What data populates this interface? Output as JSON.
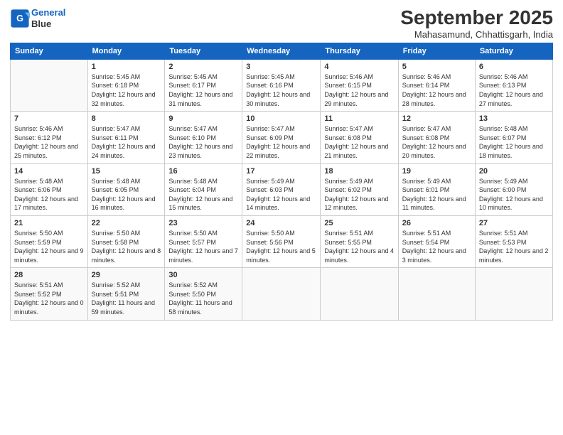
{
  "header": {
    "logo_line1": "General",
    "logo_line2": "Blue",
    "month_title": "September 2025",
    "location": "Mahasamund, Chhattisgarh, India"
  },
  "weekdays": [
    "Sunday",
    "Monday",
    "Tuesday",
    "Wednesday",
    "Thursday",
    "Friday",
    "Saturday"
  ],
  "weeks": [
    [
      {
        "day": "",
        "sunrise": "",
        "sunset": "",
        "daylight": ""
      },
      {
        "day": "1",
        "sunrise": "Sunrise: 5:45 AM",
        "sunset": "Sunset: 6:18 PM",
        "daylight": "Daylight: 12 hours and 32 minutes."
      },
      {
        "day": "2",
        "sunrise": "Sunrise: 5:45 AM",
        "sunset": "Sunset: 6:17 PM",
        "daylight": "Daylight: 12 hours and 31 minutes."
      },
      {
        "day": "3",
        "sunrise": "Sunrise: 5:45 AM",
        "sunset": "Sunset: 6:16 PM",
        "daylight": "Daylight: 12 hours and 30 minutes."
      },
      {
        "day": "4",
        "sunrise": "Sunrise: 5:46 AM",
        "sunset": "Sunset: 6:15 PM",
        "daylight": "Daylight: 12 hours and 29 minutes."
      },
      {
        "day": "5",
        "sunrise": "Sunrise: 5:46 AM",
        "sunset": "Sunset: 6:14 PM",
        "daylight": "Daylight: 12 hours and 28 minutes."
      },
      {
        "day": "6",
        "sunrise": "Sunrise: 5:46 AM",
        "sunset": "Sunset: 6:13 PM",
        "daylight": "Daylight: 12 hours and 27 minutes."
      }
    ],
    [
      {
        "day": "7",
        "sunrise": "Sunrise: 5:46 AM",
        "sunset": "Sunset: 6:12 PM",
        "daylight": "Daylight: 12 hours and 25 minutes."
      },
      {
        "day": "8",
        "sunrise": "Sunrise: 5:47 AM",
        "sunset": "Sunset: 6:11 PM",
        "daylight": "Daylight: 12 hours and 24 minutes."
      },
      {
        "day": "9",
        "sunrise": "Sunrise: 5:47 AM",
        "sunset": "Sunset: 6:10 PM",
        "daylight": "Daylight: 12 hours and 23 minutes."
      },
      {
        "day": "10",
        "sunrise": "Sunrise: 5:47 AM",
        "sunset": "Sunset: 6:09 PM",
        "daylight": "Daylight: 12 hours and 22 minutes."
      },
      {
        "day": "11",
        "sunrise": "Sunrise: 5:47 AM",
        "sunset": "Sunset: 6:08 PM",
        "daylight": "Daylight: 12 hours and 21 minutes."
      },
      {
        "day": "12",
        "sunrise": "Sunrise: 5:47 AM",
        "sunset": "Sunset: 6:08 PM",
        "daylight": "Daylight: 12 hours and 20 minutes."
      },
      {
        "day": "13",
        "sunrise": "Sunrise: 5:48 AM",
        "sunset": "Sunset: 6:07 PM",
        "daylight": "Daylight: 12 hours and 18 minutes."
      }
    ],
    [
      {
        "day": "14",
        "sunrise": "Sunrise: 5:48 AM",
        "sunset": "Sunset: 6:06 PM",
        "daylight": "Daylight: 12 hours and 17 minutes."
      },
      {
        "day": "15",
        "sunrise": "Sunrise: 5:48 AM",
        "sunset": "Sunset: 6:05 PM",
        "daylight": "Daylight: 12 hours and 16 minutes."
      },
      {
        "day": "16",
        "sunrise": "Sunrise: 5:48 AM",
        "sunset": "Sunset: 6:04 PM",
        "daylight": "Daylight: 12 hours and 15 minutes."
      },
      {
        "day": "17",
        "sunrise": "Sunrise: 5:49 AM",
        "sunset": "Sunset: 6:03 PM",
        "daylight": "Daylight: 12 hours and 14 minutes."
      },
      {
        "day": "18",
        "sunrise": "Sunrise: 5:49 AM",
        "sunset": "Sunset: 6:02 PM",
        "daylight": "Daylight: 12 hours and 12 minutes."
      },
      {
        "day": "19",
        "sunrise": "Sunrise: 5:49 AM",
        "sunset": "Sunset: 6:01 PM",
        "daylight": "Daylight: 12 hours and 11 minutes."
      },
      {
        "day": "20",
        "sunrise": "Sunrise: 5:49 AM",
        "sunset": "Sunset: 6:00 PM",
        "daylight": "Daylight: 12 hours and 10 minutes."
      }
    ],
    [
      {
        "day": "21",
        "sunrise": "Sunrise: 5:50 AM",
        "sunset": "Sunset: 5:59 PM",
        "daylight": "Daylight: 12 hours and 9 minutes."
      },
      {
        "day": "22",
        "sunrise": "Sunrise: 5:50 AM",
        "sunset": "Sunset: 5:58 PM",
        "daylight": "Daylight: 12 hours and 8 minutes."
      },
      {
        "day": "23",
        "sunrise": "Sunrise: 5:50 AM",
        "sunset": "Sunset: 5:57 PM",
        "daylight": "Daylight: 12 hours and 7 minutes."
      },
      {
        "day": "24",
        "sunrise": "Sunrise: 5:50 AM",
        "sunset": "Sunset: 5:56 PM",
        "daylight": "Daylight: 12 hours and 5 minutes."
      },
      {
        "day": "25",
        "sunrise": "Sunrise: 5:51 AM",
        "sunset": "Sunset: 5:55 PM",
        "daylight": "Daylight: 12 hours and 4 minutes."
      },
      {
        "day": "26",
        "sunrise": "Sunrise: 5:51 AM",
        "sunset": "Sunset: 5:54 PM",
        "daylight": "Daylight: 12 hours and 3 minutes."
      },
      {
        "day": "27",
        "sunrise": "Sunrise: 5:51 AM",
        "sunset": "Sunset: 5:53 PM",
        "daylight": "Daylight: 12 hours and 2 minutes."
      }
    ],
    [
      {
        "day": "28",
        "sunrise": "Sunrise: 5:51 AM",
        "sunset": "Sunset: 5:52 PM",
        "daylight": "Daylight: 12 hours and 0 minutes."
      },
      {
        "day": "29",
        "sunrise": "Sunrise: 5:52 AM",
        "sunset": "Sunset: 5:51 PM",
        "daylight": "Daylight: 11 hours and 59 minutes."
      },
      {
        "day": "30",
        "sunrise": "Sunrise: 5:52 AM",
        "sunset": "Sunset: 5:50 PM",
        "daylight": "Daylight: 11 hours and 58 minutes."
      },
      {
        "day": "",
        "sunrise": "",
        "sunset": "",
        "daylight": ""
      },
      {
        "day": "",
        "sunrise": "",
        "sunset": "",
        "daylight": ""
      },
      {
        "day": "",
        "sunrise": "",
        "sunset": "",
        "daylight": ""
      },
      {
        "day": "",
        "sunrise": "",
        "sunset": "",
        "daylight": ""
      }
    ]
  ]
}
